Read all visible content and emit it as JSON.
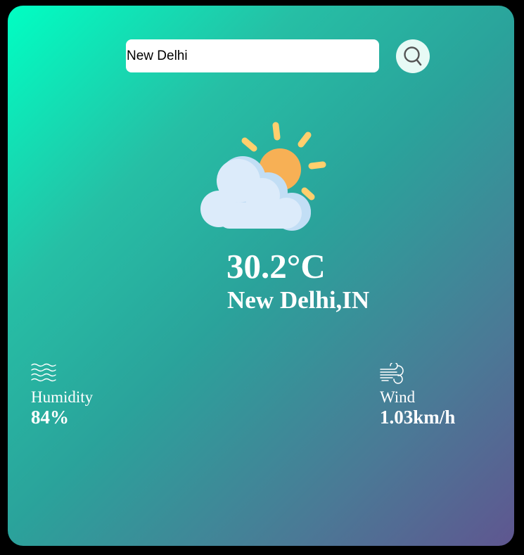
{
  "search": {
    "value": "New Delhi",
    "icon": "search-icon"
  },
  "weather": {
    "icon": "partly-cloudy-icon",
    "temperature": "30.2°C",
    "location": "New Delhi,IN"
  },
  "humidity": {
    "icon": "humidity-waves-icon",
    "label": "Humidity",
    "value": "84%"
  },
  "wind": {
    "icon": "wind-icon",
    "label": "Wind",
    "value": "1.03km/h"
  },
  "colors": {
    "gradient_start": "#00ffc3",
    "gradient_end": "#5f5690",
    "sun": "#f7b055",
    "sun_rays": "#ffcf6d",
    "cloud": "#dcebfa",
    "cloud_shadow": "#c2def5"
  }
}
